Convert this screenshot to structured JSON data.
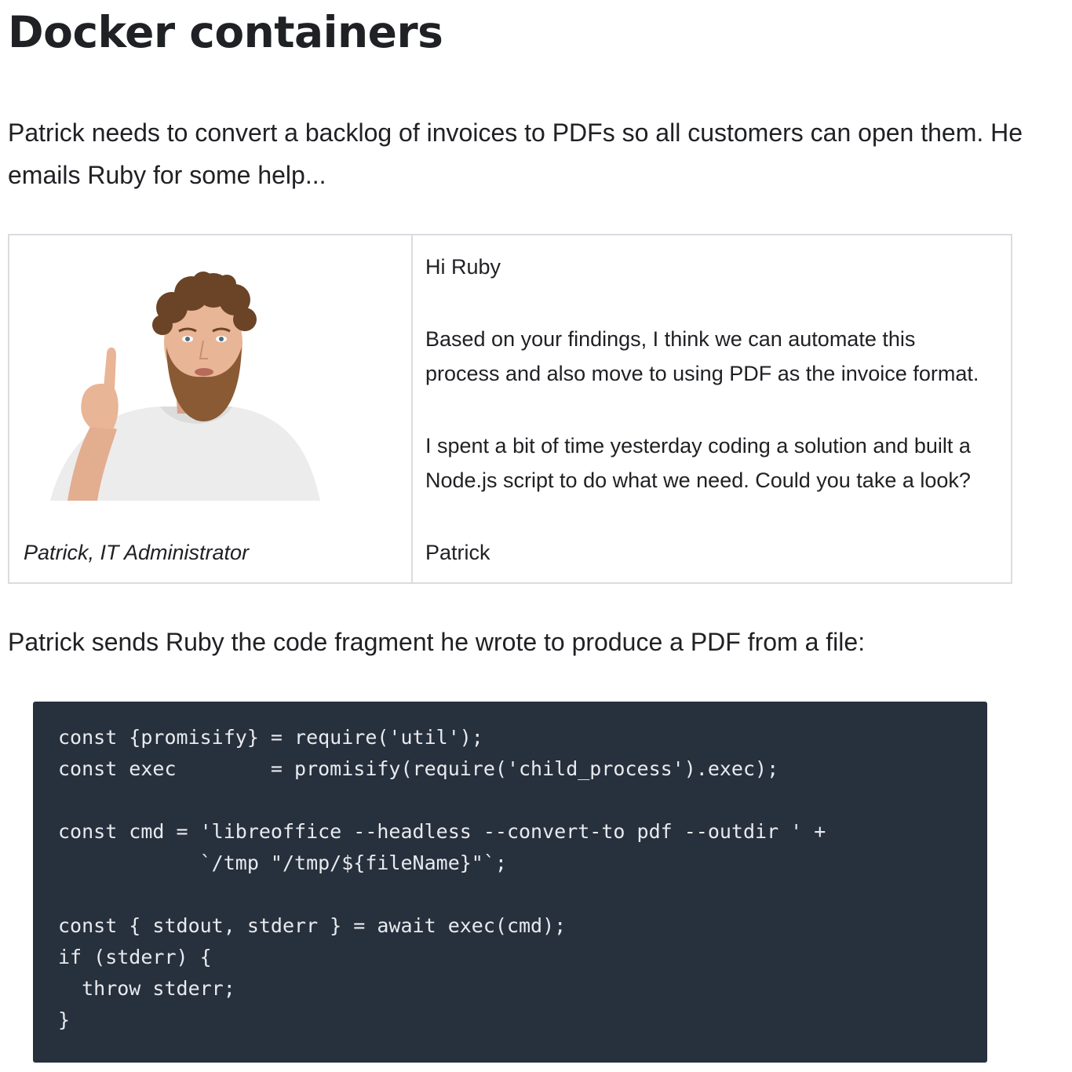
{
  "page": {
    "title": "Docker containers",
    "intro": "Patrick needs to convert a backlog of invoices to PDFs so all customers can open them. He emails Ruby for some help..."
  },
  "email": {
    "caption": "Patrick, IT Administrator",
    "greeting": "Hi Ruby",
    "paragraph1_line1": "Based on your findings, I think we can automate this",
    "paragraph1_line2": "process and also move to using PDF as the invoice format.",
    "paragraph2_line1": "I spent a bit of time yesterday coding a solution and built a",
    "paragraph2_line2": "Node.js script to do what we need. Could you take a look?",
    "signature": "Patrick",
    "colors": {
      "skin": "#e8b596",
      "hair": "#6b4326",
      "beard": "#8a5a34",
      "shirt": "#eeeeee"
    }
  },
  "section2": {
    "lead": "Patrick sends Ruby the code fragment he wrote to produce a PDF from a file:"
  },
  "code": {
    "lines": [
      "const {promisify} = require('util');",
      "const exec        = promisify(require('child_process').exec);",
      "",
      "const cmd = 'libreoffice --headless --convert-to pdf --outdir ' +",
      "            `/tmp \"/tmp/${fileName}\"`;",
      "",
      "const { stdout, stderr } = await exec(cmd);",
      "if (stderr) {",
      "  throw stderr;",
      "}"
    ],
    "background": "#27303d"
  }
}
